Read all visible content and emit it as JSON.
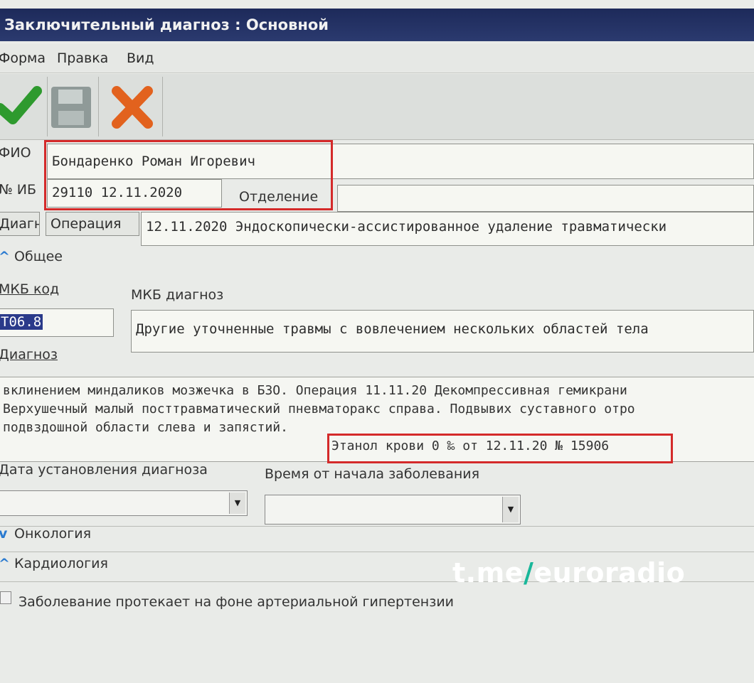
{
  "window": {
    "title": "Заключительный диагноз : Основной"
  },
  "menu": [
    "Форма",
    "Правка",
    "Вид"
  ],
  "toolbar": {
    "buttons": [
      {
        "icon": "checkmark-icon"
      },
      {
        "icon": "floppy-disk-icon"
      },
      {
        "icon": "close-x-icon"
      }
    ]
  },
  "patient": {
    "fio_label": "ФИО",
    "fio_value": "Бондаренко Роман Игоревич",
    "ib_label": "№ ИБ",
    "ib_value": "29110 12.11.2020",
    "department_label": "Отделение",
    "department_value": ""
  },
  "tabs": {
    "diag": "Диагн",
    "operation": "Операция"
  },
  "operation_text": "12.11.2020 Эндоскопически-ассистированное удаление травматически",
  "general": {
    "header": "Общее",
    "mkb_code_label": "МКБ код",
    "mkb_diag_label": "МКБ диагноз",
    "mkb_code": "T06.8",
    "mkb_diagnosis": "Другие уточненные травмы с вовлечением нескольких областей тела",
    "diagnosis_label": "Диагноз",
    "diagnosis_lines": [
      "вклинением миндаликов мозжечка в БЗО. Операция 11.11.20 Декомпрессивная гемикрани",
      "Верхушечный малый посттравматический пневматоракс справа. Подвывих суставного отро",
      "подвздошной области слева и запястий."
    ],
    "diagnosis_highlight": "Этанол крови 0 ‰ от 12.11.20 № 15906",
    "date_label": "Дата установления диагноза",
    "time_label": "Время от начала заболевания"
  },
  "sections": {
    "oncology": "Онкология",
    "cardiology": "Кардиология"
  },
  "hypertension_label": "Заболевание протекает на фоне артериальной гипертензии",
  "watermark": {
    "part1": "t.me",
    "slash": "/",
    "part2": "euroradio"
  },
  "colors": {
    "highlight_box": "#d42a2a",
    "title_bar": "#1d2a5a",
    "chevron": "#2a7ad0"
  }
}
